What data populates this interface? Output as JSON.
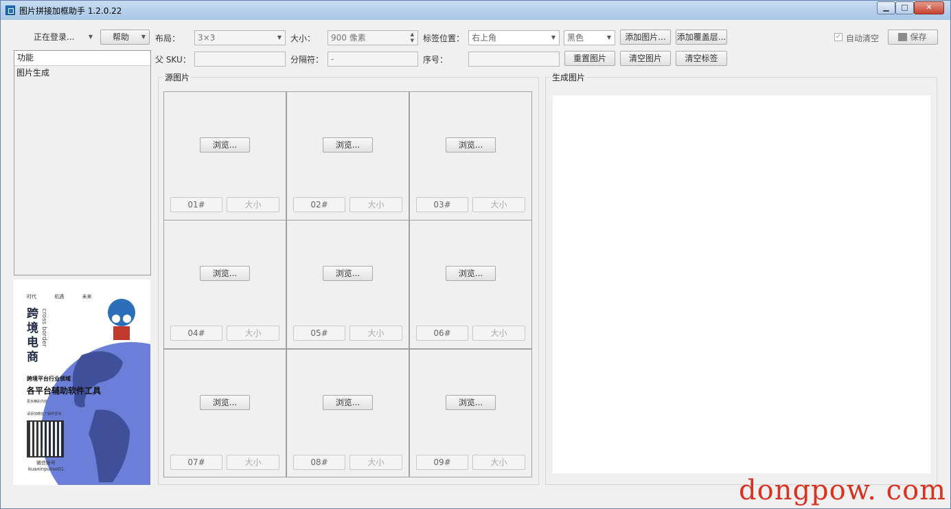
{
  "window": {
    "title": "图片拼接加框助手 1.2.0.22",
    "min": "▁",
    "max": "□",
    "close": "✕"
  },
  "toolbar": {
    "login_status": "正在登录...",
    "help": "帮助",
    "layout_label": "布局：",
    "layout_value": "3×3",
    "size_label": "大小：",
    "size_value": "900 像素",
    "tag_pos_label": "标签位置：",
    "tag_pos_value": "右上角",
    "color_value": "黑色",
    "add_image": "添加图片...",
    "add_overlay": "添加覆盖层...",
    "auto_clear": "自动清空",
    "save": "保存",
    "parent_sku_label": "父 SKU：",
    "separator_label": "分隔符：",
    "separator_value": "-",
    "seq_label": "序号：",
    "reset_images": "重置图片",
    "clear_images": "清空图片",
    "clear_tags": "清空标签"
  },
  "sidebar": {
    "header": "功能",
    "items": [
      "图片生成"
    ]
  },
  "promo": {
    "top_words": [
      "时代",
      "机遇",
      "未来"
    ],
    "vertical_title": "跨境电商",
    "vertical_en": "cross border",
    "line1": "跨境平台行业领域",
    "line2": "各平台辅助软件工具",
    "line3": "更多精彩内容",
    "line4": "请添加微信了解并咨询",
    "wechat": "微信账号",
    "wechat_id": "kuaxinputao01"
  },
  "source": {
    "title": "源图片",
    "browse": "浏览...",
    "size": "大小",
    "cells": [
      "01#",
      "02#",
      "03#",
      "04#",
      "05#",
      "06#",
      "07#",
      "08#",
      "09#"
    ]
  },
  "output": {
    "title": "生成图片"
  },
  "watermark": "dongpow. com",
  "colors": {
    "titlebar": "#b8d1ee",
    "background": "#f0f0f0",
    "watermark": "#d9321f",
    "globe": "#6b7fd8"
  }
}
